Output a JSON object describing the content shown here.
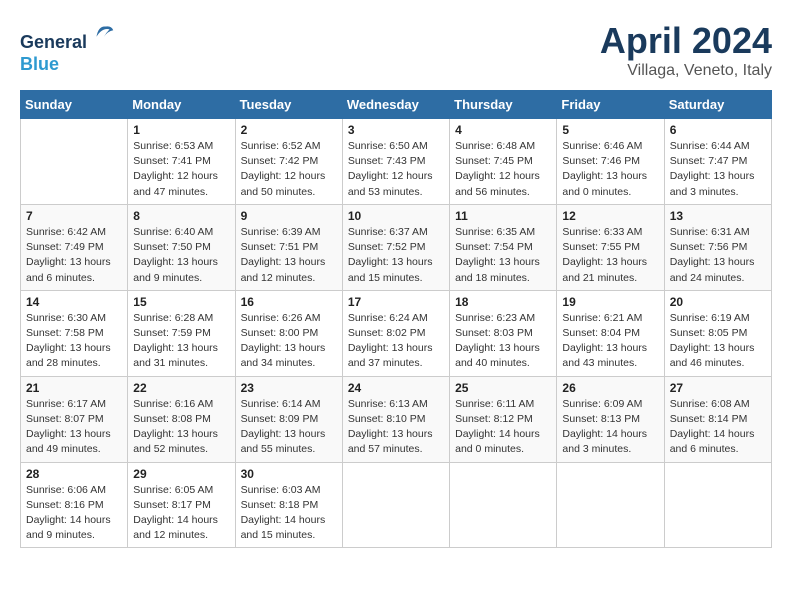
{
  "header": {
    "logo_line1": "General",
    "logo_line2": "Blue",
    "title": "April 2024",
    "subtitle": "Villaga, Veneto, Italy"
  },
  "columns": [
    "Sunday",
    "Monday",
    "Tuesday",
    "Wednesday",
    "Thursday",
    "Friday",
    "Saturday"
  ],
  "weeks": [
    [
      {
        "day": "",
        "info": ""
      },
      {
        "day": "1",
        "info": "Sunrise: 6:53 AM\nSunset: 7:41 PM\nDaylight: 12 hours\nand 47 minutes."
      },
      {
        "day": "2",
        "info": "Sunrise: 6:52 AM\nSunset: 7:42 PM\nDaylight: 12 hours\nand 50 minutes."
      },
      {
        "day": "3",
        "info": "Sunrise: 6:50 AM\nSunset: 7:43 PM\nDaylight: 12 hours\nand 53 minutes."
      },
      {
        "day": "4",
        "info": "Sunrise: 6:48 AM\nSunset: 7:45 PM\nDaylight: 12 hours\nand 56 minutes."
      },
      {
        "day": "5",
        "info": "Sunrise: 6:46 AM\nSunset: 7:46 PM\nDaylight: 13 hours\nand 0 minutes."
      },
      {
        "day": "6",
        "info": "Sunrise: 6:44 AM\nSunset: 7:47 PM\nDaylight: 13 hours\nand 3 minutes."
      }
    ],
    [
      {
        "day": "7",
        "info": "Sunrise: 6:42 AM\nSunset: 7:49 PM\nDaylight: 13 hours\nand 6 minutes."
      },
      {
        "day": "8",
        "info": "Sunrise: 6:40 AM\nSunset: 7:50 PM\nDaylight: 13 hours\nand 9 minutes."
      },
      {
        "day": "9",
        "info": "Sunrise: 6:39 AM\nSunset: 7:51 PM\nDaylight: 13 hours\nand 12 minutes."
      },
      {
        "day": "10",
        "info": "Sunrise: 6:37 AM\nSunset: 7:52 PM\nDaylight: 13 hours\nand 15 minutes."
      },
      {
        "day": "11",
        "info": "Sunrise: 6:35 AM\nSunset: 7:54 PM\nDaylight: 13 hours\nand 18 minutes."
      },
      {
        "day": "12",
        "info": "Sunrise: 6:33 AM\nSunset: 7:55 PM\nDaylight: 13 hours\nand 21 minutes."
      },
      {
        "day": "13",
        "info": "Sunrise: 6:31 AM\nSunset: 7:56 PM\nDaylight: 13 hours\nand 24 minutes."
      }
    ],
    [
      {
        "day": "14",
        "info": "Sunrise: 6:30 AM\nSunset: 7:58 PM\nDaylight: 13 hours\nand 28 minutes."
      },
      {
        "day": "15",
        "info": "Sunrise: 6:28 AM\nSunset: 7:59 PM\nDaylight: 13 hours\nand 31 minutes."
      },
      {
        "day": "16",
        "info": "Sunrise: 6:26 AM\nSunset: 8:00 PM\nDaylight: 13 hours\nand 34 minutes."
      },
      {
        "day": "17",
        "info": "Sunrise: 6:24 AM\nSunset: 8:02 PM\nDaylight: 13 hours\nand 37 minutes."
      },
      {
        "day": "18",
        "info": "Sunrise: 6:23 AM\nSunset: 8:03 PM\nDaylight: 13 hours\nand 40 minutes."
      },
      {
        "day": "19",
        "info": "Sunrise: 6:21 AM\nSunset: 8:04 PM\nDaylight: 13 hours\nand 43 minutes."
      },
      {
        "day": "20",
        "info": "Sunrise: 6:19 AM\nSunset: 8:05 PM\nDaylight: 13 hours\nand 46 minutes."
      }
    ],
    [
      {
        "day": "21",
        "info": "Sunrise: 6:17 AM\nSunset: 8:07 PM\nDaylight: 13 hours\nand 49 minutes."
      },
      {
        "day": "22",
        "info": "Sunrise: 6:16 AM\nSunset: 8:08 PM\nDaylight: 13 hours\nand 52 minutes."
      },
      {
        "day": "23",
        "info": "Sunrise: 6:14 AM\nSunset: 8:09 PM\nDaylight: 13 hours\nand 55 minutes."
      },
      {
        "day": "24",
        "info": "Sunrise: 6:13 AM\nSunset: 8:10 PM\nDaylight: 13 hours\nand 57 minutes."
      },
      {
        "day": "25",
        "info": "Sunrise: 6:11 AM\nSunset: 8:12 PM\nDaylight: 14 hours\nand 0 minutes."
      },
      {
        "day": "26",
        "info": "Sunrise: 6:09 AM\nSunset: 8:13 PM\nDaylight: 14 hours\nand 3 minutes."
      },
      {
        "day": "27",
        "info": "Sunrise: 6:08 AM\nSunset: 8:14 PM\nDaylight: 14 hours\nand 6 minutes."
      }
    ],
    [
      {
        "day": "28",
        "info": "Sunrise: 6:06 AM\nSunset: 8:16 PM\nDaylight: 14 hours\nand 9 minutes."
      },
      {
        "day": "29",
        "info": "Sunrise: 6:05 AM\nSunset: 8:17 PM\nDaylight: 14 hours\nand 12 minutes."
      },
      {
        "day": "30",
        "info": "Sunrise: 6:03 AM\nSunset: 8:18 PM\nDaylight: 14 hours\nand 15 minutes."
      },
      {
        "day": "",
        "info": ""
      },
      {
        "day": "",
        "info": ""
      },
      {
        "day": "",
        "info": ""
      },
      {
        "day": "",
        "info": ""
      }
    ]
  ]
}
